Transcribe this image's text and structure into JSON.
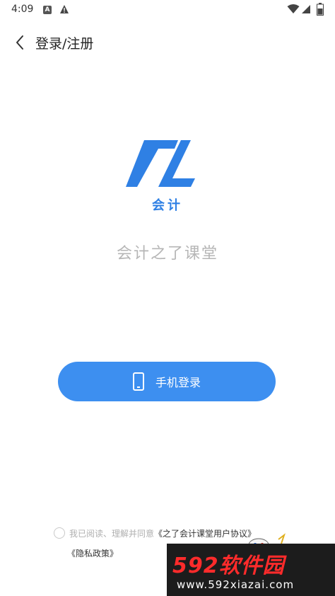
{
  "status_bar": {
    "time": "4:09",
    "a_badge": "A"
  },
  "header": {
    "title": "登录/注册"
  },
  "logo": {
    "brand": "会计"
  },
  "app": {
    "name": "会计之了课堂"
  },
  "login": {
    "label": "手机登录"
  },
  "agreement": {
    "prefix": "我已阅读、理解并同意",
    "user_agreement_link": "《之了会计课堂用户协议》",
    "privacy_link": "《隐私政策》"
  },
  "watermark": {
    "brand": "592软件园",
    "url": "www.592xiazai.com"
  },
  "colors": {
    "accent": "#3d8ff0",
    "logo_blue": "#2f80e4",
    "watermark_red": "#ff2b2b"
  },
  "icons": [
    "warning-icon",
    "wifi-icon",
    "signal-icon",
    "battery-icon",
    "back-arrow-icon",
    "phone-icon",
    "logo-mark"
  ]
}
